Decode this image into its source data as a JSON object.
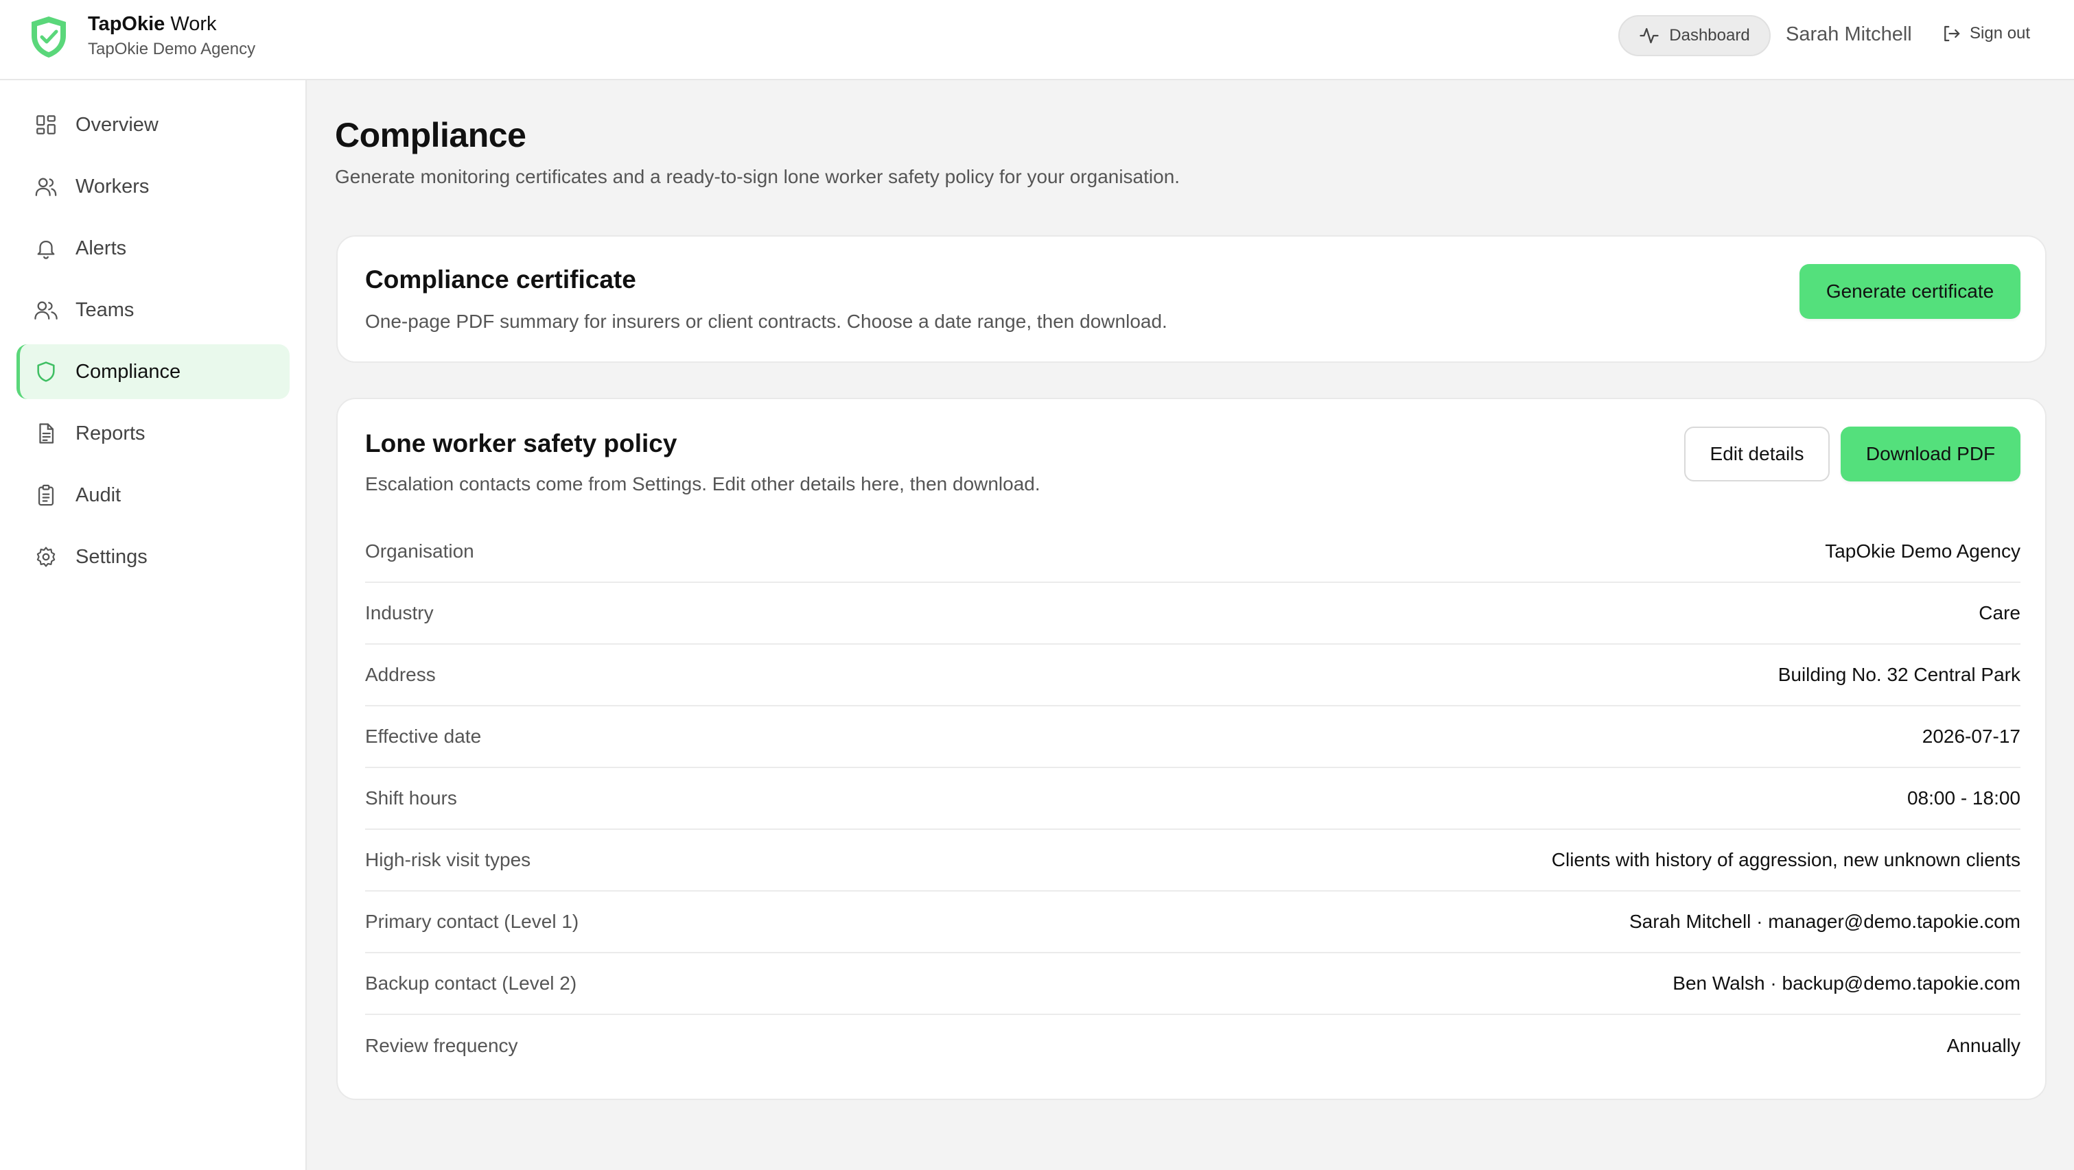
{
  "header": {
    "brand_name": "TapOkie",
    "brand_suffix": "Work",
    "org_name": "TapOkie Demo Agency",
    "dashboard_label": "Dashboard",
    "user_name": "Sarah Mitchell",
    "sign_out_label": "Sign out"
  },
  "sidebar": {
    "items": [
      {
        "label": "Overview",
        "icon": "grid-icon"
      },
      {
        "label": "Workers",
        "icon": "users-icon"
      },
      {
        "label": "Alerts",
        "icon": "bell-icon"
      },
      {
        "label": "Teams",
        "icon": "team-icon"
      },
      {
        "label": "Compliance",
        "icon": "shield-icon",
        "active": true
      },
      {
        "label": "Reports",
        "icon": "document-icon"
      },
      {
        "label": "Audit",
        "icon": "clipboard-icon"
      },
      {
        "label": "Settings",
        "icon": "gear-icon"
      }
    ]
  },
  "main": {
    "title": "Compliance",
    "subtitle": "Generate monitoring certificates and a ready-to-sign lone worker safety policy for your organisation.",
    "certificate": {
      "title": "Compliance certificate",
      "description": "One-page PDF summary for insurers or client contracts. Choose a date range, then download.",
      "button_label": "Generate certificate"
    },
    "policy": {
      "title": "Lone worker safety policy",
      "description": "Escalation contacts come from Settings. Edit other details here, then download.",
      "edit_label": "Edit details",
      "download_label": "Download PDF",
      "rows": [
        {
          "label": "Organisation",
          "value": "TapOkie Demo Agency"
        },
        {
          "label": "Industry",
          "value": "Care"
        },
        {
          "label": "Address",
          "value": "Building No. 32 Central Park"
        },
        {
          "label": "Effective date",
          "value": "2026-07-17"
        },
        {
          "label": "Shift hours",
          "value": "08:00 - 18:00"
        },
        {
          "label": "High-risk visit types",
          "value": "Clients with history of aggression, new unknown clients"
        },
        {
          "label": "Primary contact (Level 1)",
          "value": "Sarah Mitchell · manager@demo.tapokie.com"
        },
        {
          "label": "Backup contact (Level 2)",
          "value": "Ben Walsh · backup@demo.tapokie.com"
        },
        {
          "label": "Review frequency",
          "value": "Annually"
        }
      ]
    }
  },
  "colors": {
    "accent": "#54e07c",
    "active_bg": "#e9f9ec",
    "page_bg": "#f3f3f3"
  }
}
